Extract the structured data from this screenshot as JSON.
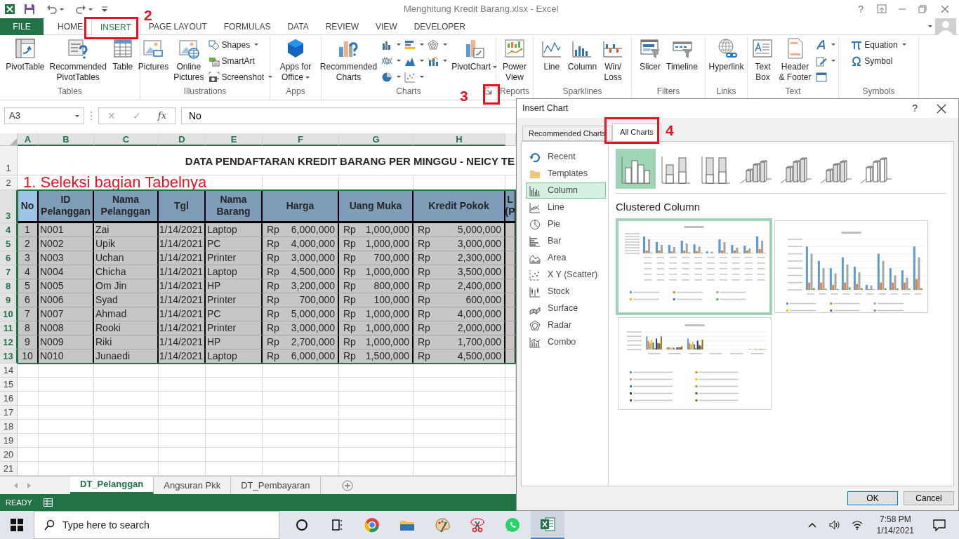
{
  "title_bar": {
    "title": "Menghitung Kredit Barang.xlsx - Excel",
    "help": "?"
  },
  "ribbon_tabs": [
    {
      "label": "FILE",
      "kind": "file",
      "selected": false
    },
    {
      "label": "HOME",
      "kind": "tab",
      "selected": false
    },
    {
      "label": "INSERT",
      "kind": "tab",
      "selected": true
    },
    {
      "label": "PAGE LAYOUT",
      "kind": "tab",
      "selected": false
    },
    {
      "label": "FORMULAS",
      "kind": "tab",
      "selected": false
    },
    {
      "label": "DATA",
      "kind": "tab",
      "selected": false
    },
    {
      "label": "REVIEW",
      "kind": "tab",
      "selected": false
    },
    {
      "label": "VIEW",
      "kind": "tab",
      "selected": false
    },
    {
      "label": "DEVELOPER",
      "kind": "tab",
      "selected": false
    }
  ],
  "ribbon_groups": [
    {
      "label": "Tables",
      "launcher": false,
      "items": [
        {
          "kind": "large",
          "lines": [
            "PivotTable"
          ],
          "dropdown": false
        },
        {
          "kind": "large",
          "lines": [
            "Recommended",
            "PivotTables"
          ],
          "dropdown": false
        },
        {
          "kind": "large",
          "lines": [
            "Table"
          ],
          "dropdown": false
        }
      ]
    },
    {
      "label": "Illustrations",
      "launcher": false,
      "items": [
        {
          "kind": "large",
          "lines": [
            "Pictures"
          ],
          "dropdown": false
        },
        {
          "kind": "large",
          "lines": [
            "Online",
            "Pictures"
          ],
          "dropdown": false
        },
        {
          "kind": "small",
          "label": "Shapes",
          "dropdown": true
        },
        {
          "kind": "small",
          "label": "SmartArt",
          "dropdown": false
        },
        {
          "kind": "small",
          "label": "Screenshot",
          "dropdown": true
        }
      ]
    },
    {
      "label": "Apps",
      "launcher": false,
      "items": [
        {
          "kind": "large",
          "lines": [
            "Apps for",
            "Office"
          ],
          "dropdown": true
        }
      ]
    },
    {
      "label": "Charts",
      "launcher": true,
      "items": [
        {
          "kind": "large",
          "lines": [
            "Recommended",
            "Charts"
          ],
          "dropdown": false
        },
        {
          "kind": "icon",
          "dropdown": true
        },
        {
          "kind": "icon",
          "dropdown": true
        },
        {
          "kind": "icon",
          "dropdown": true
        },
        {
          "kind": "icon",
          "dropdown": true
        },
        {
          "kind": "icon",
          "dropdown": true
        },
        {
          "kind": "icon",
          "dropdown": true
        },
        {
          "kind": "icon",
          "dropdown": true
        },
        {
          "kind": "icon",
          "dropdown": true
        },
        {
          "kind": "large",
          "lines": [
            "PivotChart"
          ],
          "dropdown": true
        }
      ]
    },
    {
      "label": "Reports",
      "launcher": false,
      "items": [
        {
          "kind": "large",
          "lines": [
            "Power",
            "View"
          ],
          "dropdown": false
        }
      ]
    },
    {
      "label": "Sparklines",
      "launcher": false,
      "items": [
        {
          "kind": "large",
          "lines": [
            "Line"
          ],
          "dropdown": false
        },
        {
          "kind": "large",
          "lines": [
            "Column"
          ],
          "dropdown": false
        },
        {
          "kind": "large",
          "lines": [
            "Win/",
            "Loss"
          ],
          "dropdown": false
        }
      ]
    },
    {
      "label": "Filters",
      "launcher": false,
      "items": [
        {
          "kind": "large",
          "lines": [
            "Slicer"
          ],
          "dropdown": false
        },
        {
          "kind": "large",
          "lines": [
            "Timeline"
          ],
          "dropdown": false
        }
      ]
    },
    {
      "label": "Links",
      "launcher": false,
      "items": [
        {
          "kind": "large",
          "lines": [
            "Hyperlink"
          ],
          "dropdown": false
        }
      ]
    },
    {
      "label": "Text",
      "launcher": false,
      "items": [
        {
          "kind": "large",
          "lines": [
            "Text",
            "Box"
          ],
          "dropdown": false
        },
        {
          "kind": "large",
          "lines": [
            "Header",
            "& Footer"
          ],
          "dropdown": false
        },
        {
          "kind": "icon",
          "dropdown": true
        },
        {
          "kind": "icon",
          "dropdown": true
        },
        {
          "kind": "icon",
          "dropdown": false
        }
      ]
    },
    {
      "label": "Symbols",
      "launcher": false,
      "items": [
        {
          "kind": "small",
          "label": "Equation",
          "dropdown": true
        },
        {
          "kind": "small",
          "label": "Symbol",
          "dropdown": false
        }
      ]
    }
  ],
  "formula_bar": {
    "name_box": "A3",
    "cancel": "✕",
    "enter": "✓",
    "function": "fx",
    "formula": "No"
  },
  "sheet": {
    "column_headers": [
      {
        "label": "A",
        "selected": true
      },
      {
        "label": "B",
        "selected": true
      },
      {
        "label": "C",
        "selected": true
      },
      {
        "label": "D",
        "selected": true
      },
      {
        "label": "E",
        "selected": true
      },
      {
        "label": "F",
        "selected": true
      },
      {
        "label": "G",
        "selected": true
      },
      {
        "label": "H",
        "selected": true
      }
    ],
    "row_headers": [
      {
        "label": "1",
        "selected": false
      },
      {
        "label": "2",
        "selected": false
      },
      {
        "label": "3",
        "selected": true
      },
      {
        "label": "4",
        "selected": true
      },
      {
        "label": "5",
        "selected": true
      },
      {
        "label": "6",
        "selected": true
      },
      {
        "label": "7",
        "selected": true
      },
      {
        "label": "8",
        "selected": true
      },
      {
        "label": "9",
        "selected": true
      },
      {
        "label": "10",
        "selected": true
      },
      {
        "label": "11",
        "selected": true
      },
      {
        "label": "12",
        "selected": true
      },
      {
        "label": "13",
        "selected": true
      },
      {
        "label": "14",
        "selected": false
      },
      {
        "label": "15",
        "selected": false
      },
      {
        "label": "16",
        "selected": false
      },
      {
        "label": "17",
        "selected": false
      },
      {
        "label": "18",
        "selected": false
      },
      {
        "label": "19",
        "selected": false
      },
      {
        "label": "20",
        "selected": false
      },
      {
        "label": "21",
        "selected": false
      }
    ],
    "title": "DATA PENDAFTARAN KREDIT BARANG PER MINGGU - NEICY TE",
    "instruction": "1. Seleksi bagian Tabelnya",
    "table_header": [
      {
        "lines": [
          "No"
        ],
        "active": true
      },
      {
        "lines": [
          "ID",
          "Pelanggan"
        ],
        "active": false
      },
      {
        "lines": [
          "Nama",
          "Pelanggan"
        ],
        "active": false
      },
      {
        "lines": [
          "Tgl"
        ],
        "active": false
      },
      {
        "lines": [
          "Nama",
          "Barang"
        ],
        "active": false
      },
      {
        "lines": [
          "Harga"
        ],
        "active": false
      },
      {
        "lines": [
          "Uang Muka"
        ],
        "active": false
      },
      {
        "lines": [
          "Kredit Pokok"
        ],
        "active": false
      },
      {
        "lines": [
          "L",
          "(P"
        ],
        "active": false
      }
    ],
    "rows": [
      {
        "selected": true,
        "no": "1",
        "id": "N001",
        "name": "Zai",
        "date": "1/14/2021",
        "item": "Laptop",
        "price": {
          "currency": "Rp",
          "amount": "6,000,000"
        },
        "down_payment": {
          "currency": "Rp",
          "amount": "1,000,000"
        },
        "principal": {
          "currency": "Rp",
          "amount": "5,000,000"
        }
      },
      {
        "selected": true,
        "no": "2",
        "id": "N002",
        "name": "Upik",
        "date": "1/14/2021",
        "item": "PC",
        "price": {
          "currency": "Rp",
          "amount": "4,000,000"
        },
        "down_payment": {
          "currency": "Rp",
          "amount": "1,000,000"
        },
        "principal": {
          "currency": "Rp",
          "amount": "3,000,000"
        }
      },
      {
        "selected": true,
        "no": "3",
        "id": "N003",
        "name": "Uchan",
        "date": "1/14/2021",
        "item": "Printer",
        "price": {
          "currency": "Rp",
          "amount": "3,000,000"
        },
        "down_payment": {
          "currency": "Rp",
          "amount": "700,000"
        },
        "principal": {
          "currency": "Rp",
          "amount": "2,300,000"
        }
      },
      {
        "selected": true,
        "no": "4",
        "id": "N004",
        "name": "Chicha",
        "date": "1/14/2021",
        "item": "Laptop",
        "price": {
          "currency": "Rp",
          "amount": "4,500,000"
        },
        "down_payment": {
          "currency": "Rp",
          "amount": "1,000,000"
        },
        "principal": {
          "currency": "Rp",
          "amount": "3,500,000"
        }
      },
      {
        "selected": true,
        "no": "5",
        "id": "N005",
        "name": "Om Jin",
        "date": "1/14/2021",
        "item": "HP",
        "price": {
          "currency": "Rp",
          "amount": "3,200,000"
        },
        "down_payment": {
          "currency": "Rp",
          "amount": "800,000"
        },
        "principal": {
          "currency": "Rp",
          "amount": "2,400,000"
        }
      },
      {
        "selected": true,
        "no": "6",
        "id": "N006",
        "name": "Syad",
        "date": "1/14/2021",
        "item": "Printer",
        "price": {
          "currency": "Rp",
          "amount": "700,000"
        },
        "down_payment": {
          "currency": "Rp",
          "amount": "100,000"
        },
        "principal": {
          "currency": "Rp",
          "amount": "600,000"
        }
      },
      {
        "selected": true,
        "no": "7",
        "id": "N007",
        "name": "Ahmad",
        "date": "1/14/2021",
        "item": "PC",
        "price": {
          "currency": "Rp",
          "amount": "5,000,000"
        },
        "down_payment": {
          "currency": "Rp",
          "amount": "1,000,000"
        },
        "principal": {
          "currency": "Rp",
          "amount": "4,000,000"
        }
      },
      {
        "selected": true,
        "no": "8",
        "id": "N008",
        "name": "Rooki",
        "date": "1/14/2021",
        "item": "Printer",
        "price": {
          "currency": "Rp",
          "amount": "3,000,000"
        },
        "down_payment": {
          "currency": "Rp",
          "amount": "1,000,000"
        },
        "principal": {
          "currency": "Rp",
          "amount": "2,000,000"
        }
      },
      {
        "selected": true,
        "no": "9",
        "id": "N009",
        "name": "Riki",
        "date": "1/14/2021",
        "item": "HP",
        "price": {
          "currency": "Rp",
          "amount": "2,700,000"
        },
        "down_payment": {
          "currency": "Rp",
          "amount": "1,000,000"
        },
        "principal": {
          "currency": "Rp",
          "amount": "1,700,000"
        }
      },
      {
        "selected": true,
        "no": "10",
        "id": "N010",
        "name": "Junaedi",
        "date": "1/14/2021",
        "item": "Laptop",
        "price": {
          "currency": "Rp",
          "amount": "6,000,000"
        },
        "down_payment": {
          "currency": "Rp",
          "amount": "1,500,000"
        },
        "principal": {
          "currency": "Rp",
          "amount": "4,500,000"
        }
      }
    ]
  },
  "sheet_tabs": [
    {
      "label": "DT_Pelanggan",
      "selected": true
    },
    {
      "label": "Angsuran Pkk",
      "selected": false
    },
    {
      "label": "DT_Pembayaran",
      "selected": false
    }
  ],
  "status_bar": {
    "text": "READY"
  },
  "taskbar": {
    "search": {
      "placeholder": "Type here to search"
    },
    "apps": [
      {
        "active": false
      },
      {
        "active": false
      },
      {
        "active": false
      },
      {
        "active": false
      },
      {
        "active": false
      },
      {
        "active": false
      },
      {
        "active": false
      },
      {
        "active": true
      }
    ],
    "time": "7:58 PM",
    "date": "1/14/2021"
  },
  "dialog": {
    "title": "Insert Chart",
    "help": "?",
    "tabs": [
      {
        "label": "Recommended Charts",
        "selected": false
      },
      {
        "label": "All Charts",
        "selected": true
      }
    ],
    "chart_types": [
      {
        "label": "Recent",
        "selected": false
      },
      {
        "label": "Templates",
        "selected": false
      },
      {
        "label": "Column",
        "selected": true
      },
      {
        "label": "Line",
        "selected": false
      },
      {
        "label": "Pie",
        "selected": false
      },
      {
        "label": "Bar",
        "selected": false
      },
      {
        "label": "Area",
        "selected": false
      },
      {
        "label": "X Y (Scatter)",
        "selected": false
      },
      {
        "label": "Stock",
        "selected": false
      },
      {
        "label": "Surface",
        "selected": false
      },
      {
        "label": "Radar",
        "selected": false
      },
      {
        "label": "Combo",
        "selected": false
      }
    ],
    "subtypes": [
      {
        "selected": true
      },
      {
        "selected": false
      },
      {
        "selected": false
      },
      {
        "selected": false
      },
      {
        "selected": false
      },
      {
        "selected": false
      },
      {
        "selected": false
      }
    ],
    "subtype_title": "Clustered Column",
    "previews": [
      {
        "kind": "picture",
        "selected": true
      },
      {
        "kind": "picture",
        "selected": false
      },
      {
        "kind": "picture",
        "selected": false
      }
    ],
    "buttons": [
      {
        "label": "OK",
        "kind": "primary"
      },
      {
        "label": "Cancel",
        "kind": "secondary"
      }
    ]
  },
  "annotations": [
    {
      "label": "2"
    },
    {
      "label": "3"
    },
    {
      "label": "4"
    }
  ]
}
